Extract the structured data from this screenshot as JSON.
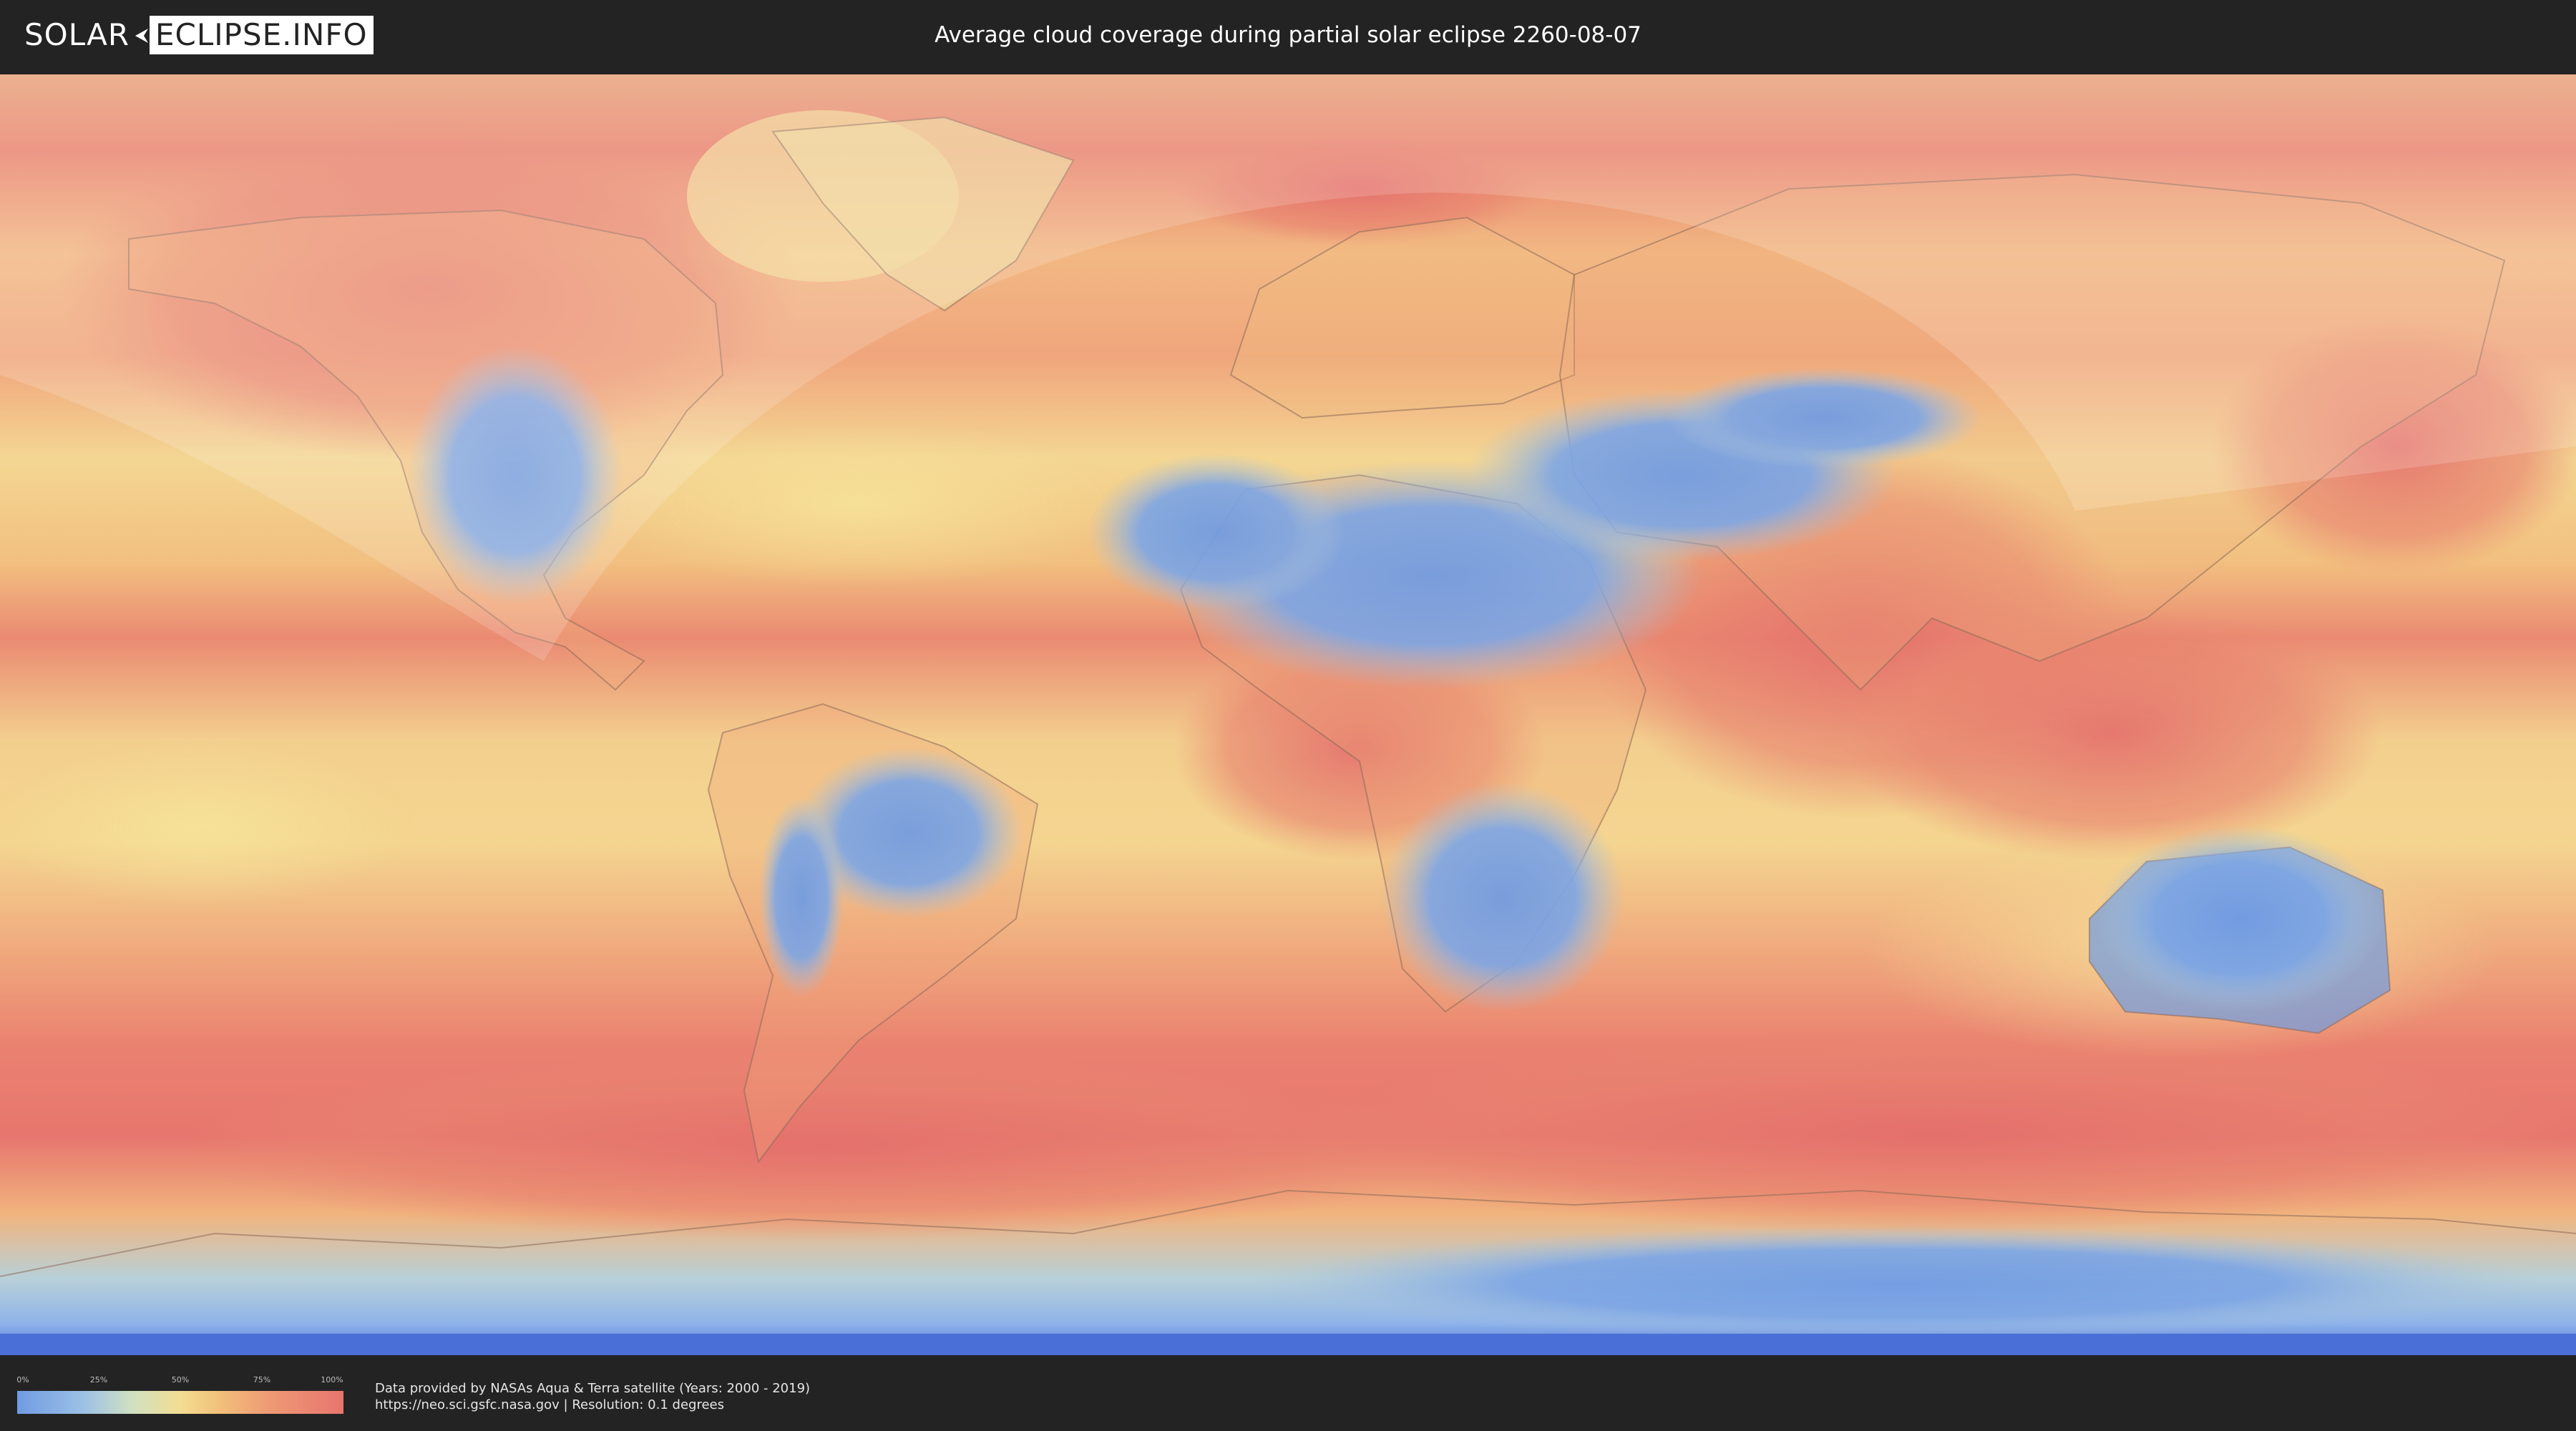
{
  "header": {
    "logo_left": "SOLAR",
    "logo_right": "ECLIPSE.INFO",
    "title": "Average cloud coverage during partial solar eclipse 2260-08-07"
  },
  "legend": {
    "ticks": [
      "0%",
      "25%",
      "50%",
      "75%",
      "100%"
    ],
    "gradient_colors": [
      "#6f9be3",
      "#9cc0e6",
      "#cfe0c2",
      "#f4dd92",
      "#f2c07a",
      "#ee9874",
      "#e8756e"
    ]
  },
  "source": {
    "line1": "Data provided by NASAs Aqua & Terra satellite (Years: 2000 - 2019)",
    "line2": "https://neo.sci.gsfc.nasa.gov | Resolution: 0.1 degrees"
  },
  "map": {
    "projection": "equirectangular world map",
    "overlay": "eclipse visibility zone (lighter shading)",
    "colors": {
      "clear": "#6f9be3",
      "partly": "#f4dd92",
      "cloudy": "#e8756e",
      "land_outline": "#8a6a5a"
    }
  }
}
